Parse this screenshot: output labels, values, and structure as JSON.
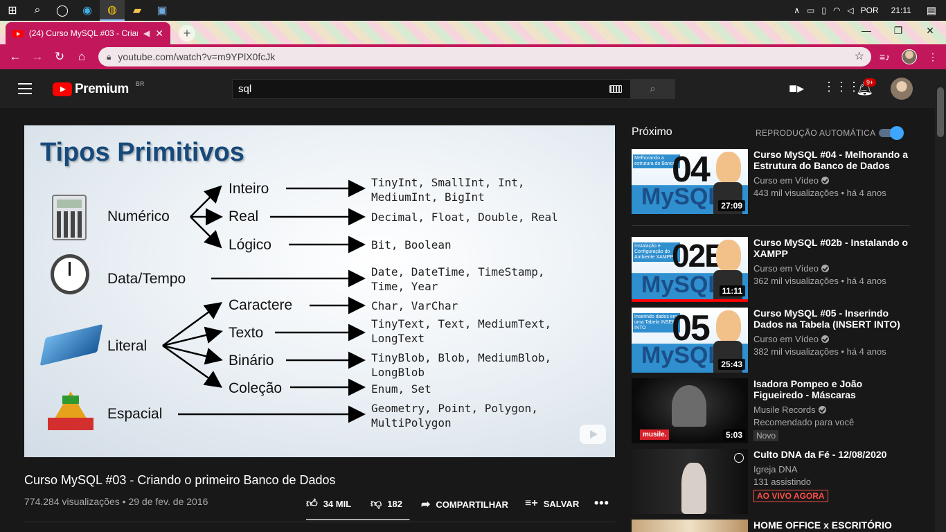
{
  "taskbar": {
    "icons": [
      "windows-icon",
      "search-icon",
      "task-view-icon",
      "edge-icon",
      "chrome-icon",
      "explorer-icon",
      "app-icon"
    ],
    "language": "POR",
    "time": "21:11"
  },
  "browser": {
    "tab_title": "(24) Curso MySQL #03 - Criand",
    "url": "youtube.com/watch?v=m9YPlX0fcJk",
    "accent": "#c2185b"
  },
  "youtube": {
    "logo_text": "Premium",
    "region": "BR",
    "search_value": "sql",
    "notifications": "9+"
  },
  "slide": {
    "title": "Tipos Primitivos",
    "categories": {
      "numerico": "Numérico",
      "data_tempo": "Data/Tempo",
      "literal": "Literal",
      "espacial": "Espacial"
    },
    "subs": {
      "inteiro": "Inteiro",
      "real": "Real",
      "logico": "Lógico",
      "caractere": "Caractere",
      "texto": "Texto",
      "binario": "Binário",
      "colecao": "Coleção"
    },
    "types": {
      "inteiro": "TinyInt, SmallInt, Int,\nMediumInt, BigInt",
      "real": "Decimal, Float, Double, Real",
      "logico": "Bit, Boolean",
      "data_tempo": "Date, DateTime, TimeStamp,\nTime, Year",
      "caractere": "Char, VarChar",
      "texto": "TinyText, Text, MediumText,\nLongText",
      "binario": "TinyBlob, Blob, MediumBlob,\nLongBlob",
      "colecao": "Enum, Set",
      "espacial": "Geometry, Point, Polygon,\nMultiPolygon"
    }
  },
  "video": {
    "title": "Curso MySQL #03 - Criando o primeiro Banco de Dados",
    "views": "774.284 visualizações",
    "date": "29 de fev. de 2016",
    "likes": "34 MIL",
    "dislikes": "182",
    "like_ratio": 0.99,
    "share": "COMPARTILHAR",
    "save": "SALVAR",
    "more": "•••"
  },
  "sidebar": {
    "next_label": "Próximo",
    "autoplay_label": "REPRODUÇÃO AUTOMÁTICA",
    "autoplay_on": true,
    "items": [
      {
        "title": "Curso MySQL #04 - Melhorando a Estrutura do Banco de Dados",
        "channel": "Curso em Vídeo",
        "meta": "443 mil visualizações • há 4 anos",
        "duration": "27:09",
        "thumb_tag": "Melhorando a estrutura do Banco",
        "thumb_num": "04",
        "thumb_word": "MySQL"
      },
      {
        "title": "Curso MySQL #02b - Instalando o XAMPP",
        "channel": "Curso em Vídeo",
        "meta": "362 mil visualizações • há 4 anos",
        "duration": "11:11",
        "thumb_tag": "Instalação e Configuração do Ambiente XAMPP",
        "thumb_num": "02B",
        "thumb_word": "MySQL"
      },
      {
        "title": "Curso MySQL #05 - Inserindo Dados na Tabela (INSERT INTO)",
        "channel": "Curso em Vídeo",
        "meta": "382 mil visualizações • há 4 anos",
        "duration": "25:43",
        "thumb_tag": "Inserindo dados em uma Tabela INSERT INTO",
        "thumb_num": "05",
        "thumb_word": "MySQL"
      },
      {
        "title": "Isadora Pompeo e João Figueiredo - Máscaras",
        "channel": "Musile Records",
        "meta": "Recomendado para você",
        "duration": "5:03",
        "badge": "Novo",
        "thumb_brand": "musile"
      },
      {
        "title": "Culto DNA da Fé - 12/08/2020",
        "channel": "Igreja DNA",
        "meta": "131 assistindo",
        "badge_live": "AO VIVO AGORA"
      },
      {
        "title": "HOME OFFICE x ESCRITÓRIO"
      }
    ]
  }
}
